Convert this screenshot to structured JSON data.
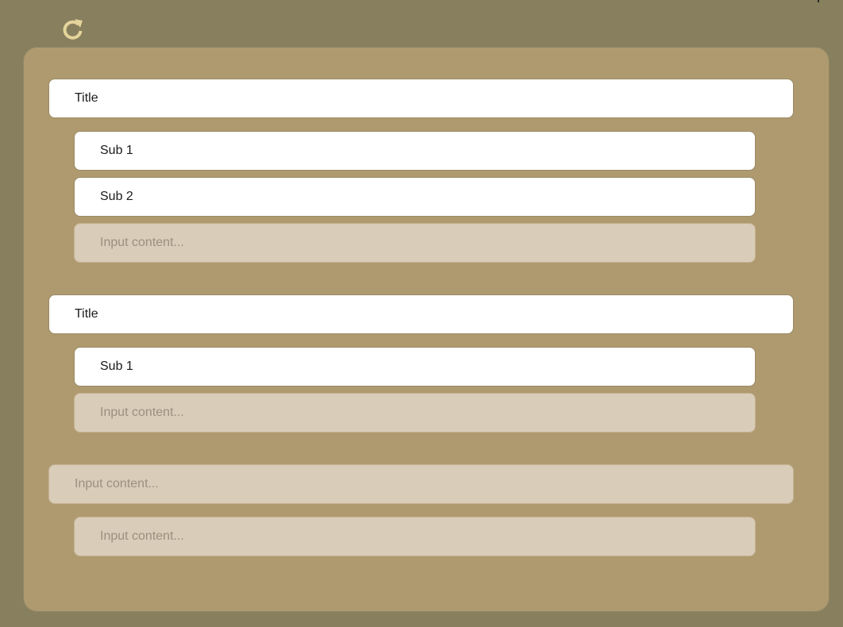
{
  "toolbar": {
    "refresh_icon": "refresh-icon",
    "icon_color": "#e5d59c"
  },
  "groups": [
    {
      "title": "Title",
      "subs": [
        "Sub 1",
        "Sub 2"
      ],
      "input_placeholder": "Input content..."
    },
    {
      "title": "Title",
      "subs": [
        "Sub 1"
      ],
      "input_placeholder": "Input content..."
    }
  ],
  "new_group": {
    "title_placeholder": "Input content...",
    "sub_placeholder": "Input content..."
  },
  "colors": {
    "background": "#877f5d",
    "panel": "#af9a6f",
    "row_filled": "#ffffff",
    "row_input": "#d9ccb8"
  }
}
